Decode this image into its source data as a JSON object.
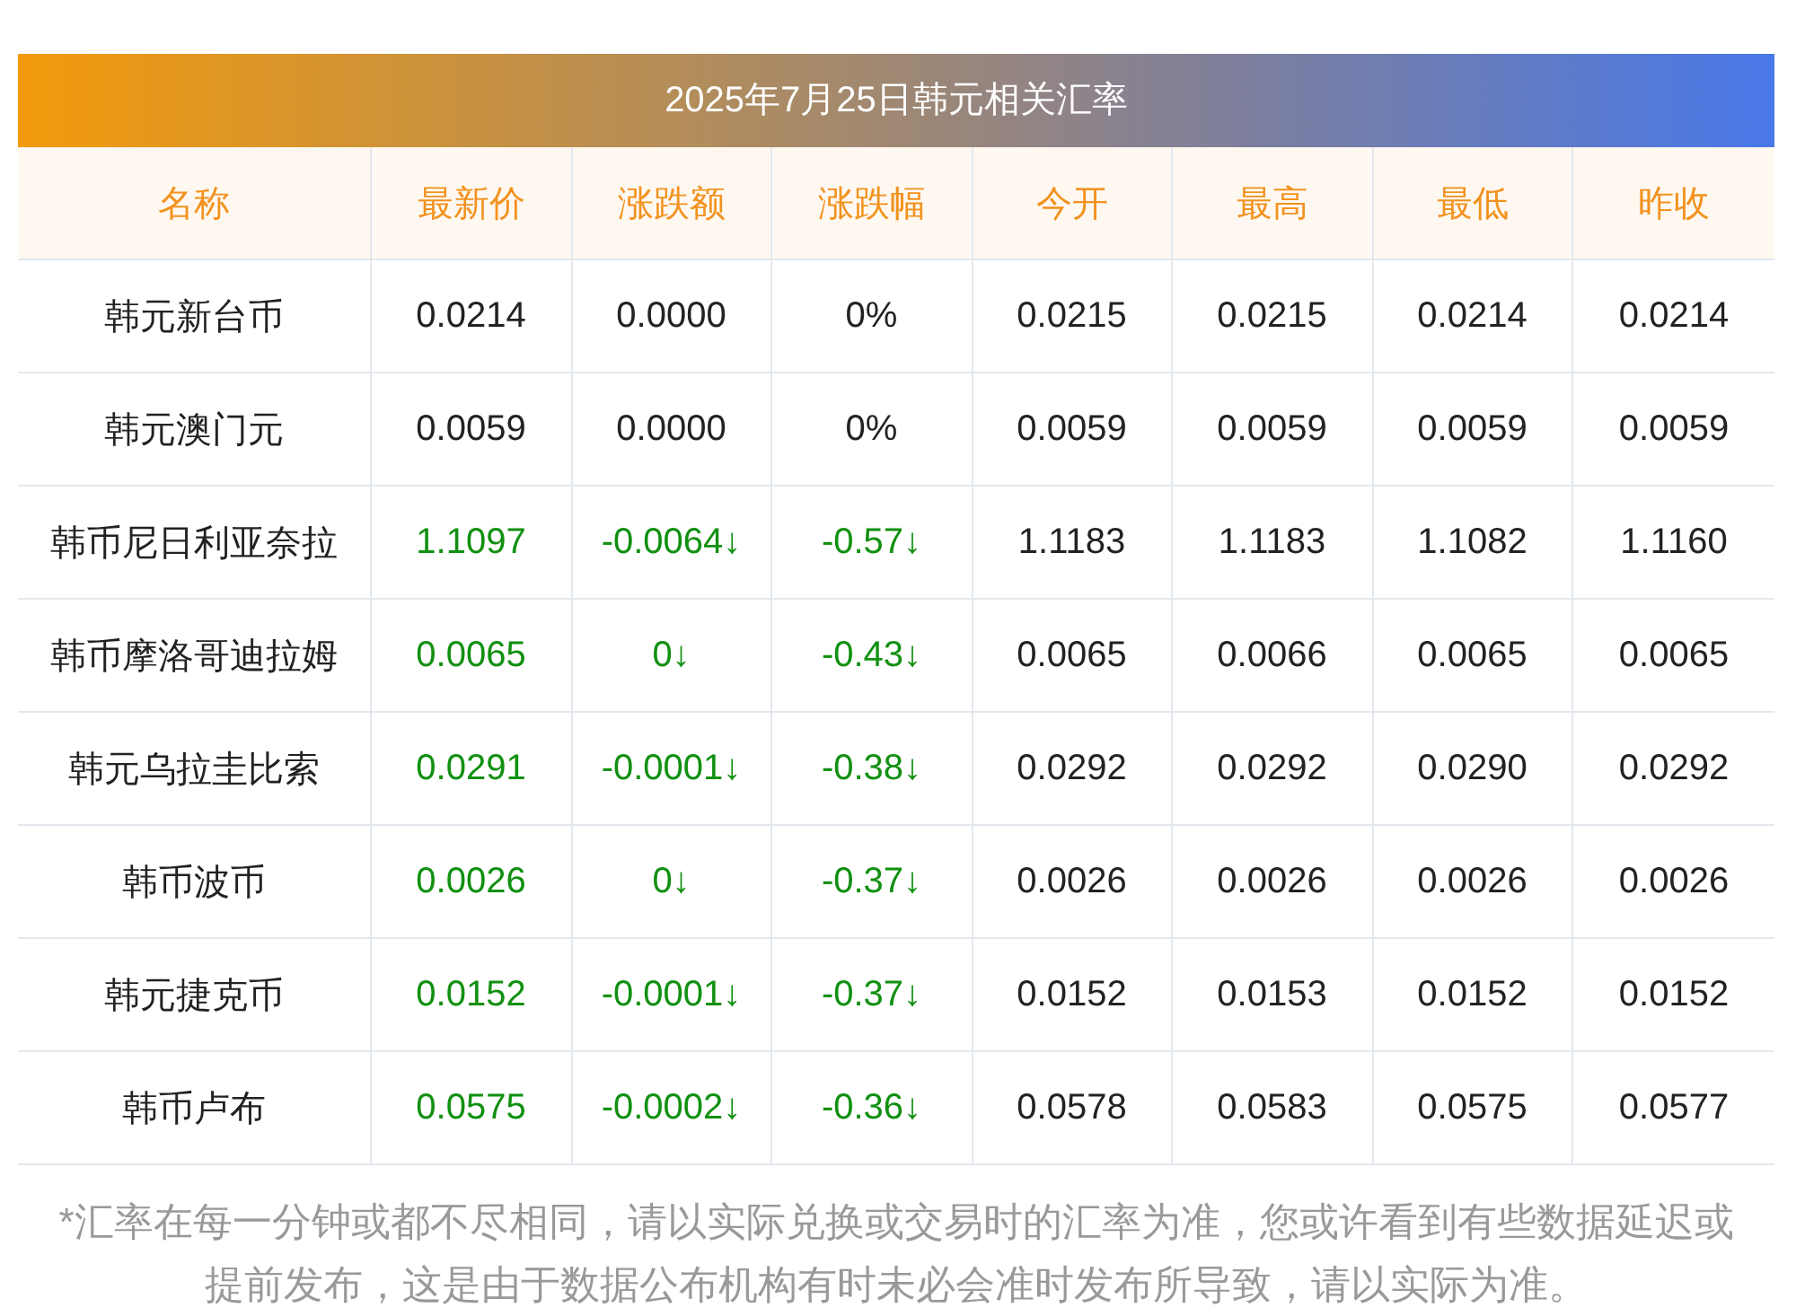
{
  "title": "2025年7月25日韩元相关汇率",
  "columns": [
    "名称",
    "最新价",
    "涨跌额",
    "涨跌幅",
    "今开",
    "最高",
    "最低",
    "昨收"
  ],
  "rows": [
    {
      "falling": false,
      "cells": [
        "韩元新台币",
        "0.0214",
        "0.0000",
        "0%",
        "0.0215",
        "0.0215",
        "0.0214",
        "0.0214"
      ]
    },
    {
      "falling": false,
      "cells": [
        "韩元澳门元",
        "0.0059",
        "0.0000",
        "0%",
        "0.0059",
        "0.0059",
        "0.0059",
        "0.0059"
      ]
    },
    {
      "falling": true,
      "cells": [
        "韩币尼日利亚奈拉",
        "1.1097",
        "-0.0064↓",
        "-0.57↓",
        "1.1183",
        "1.1183",
        "1.1082",
        "1.1160"
      ]
    },
    {
      "falling": true,
      "cells": [
        "韩币摩洛哥迪拉姆",
        "0.0065",
        "0↓",
        "-0.43↓",
        "0.0065",
        "0.0066",
        "0.0065",
        "0.0065"
      ]
    },
    {
      "falling": true,
      "cells": [
        "韩元乌拉圭比索",
        "0.0291",
        "-0.0001↓",
        "-0.38↓",
        "0.0292",
        "0.0292",
        "0.0290",
        "0.0292"
      ]
    },
    {
      "falling": true,
      "cells": [
        "韩币波币",
        "0.0026",
        "0↓",
        "-0.37↓",
        "0.0026",
        "0.0026",
        "0.0026",
        "0.0026"
      ]
    },
    {
      "falling": true,
      "cells": [
        "韩元捷克币",
        "0.0152",
        "-0.0001↓",
        "-0.37↓",
        "0.0152",
        "0.0153",
        "0.0152",
        "0.0152"
      ]
    },
    {
      "falling": true,
      "cells": [
        "韩币卢布",
        "0.0575",
        "-0.0002↓",
        "-0.36↓",
        "0.0578",
        "0.0583",
        "0.0575",
        "0.0577"
      ]
    }
  ],
  "note": "*汇率在每一分钟或都不尽相同，请以实际兑换或交易时的汇率为准，您或许看到有些数据延迟或提前发布，这是由于数据公布机构有时未必会准时发布所导致，请以实际为准。"
}
